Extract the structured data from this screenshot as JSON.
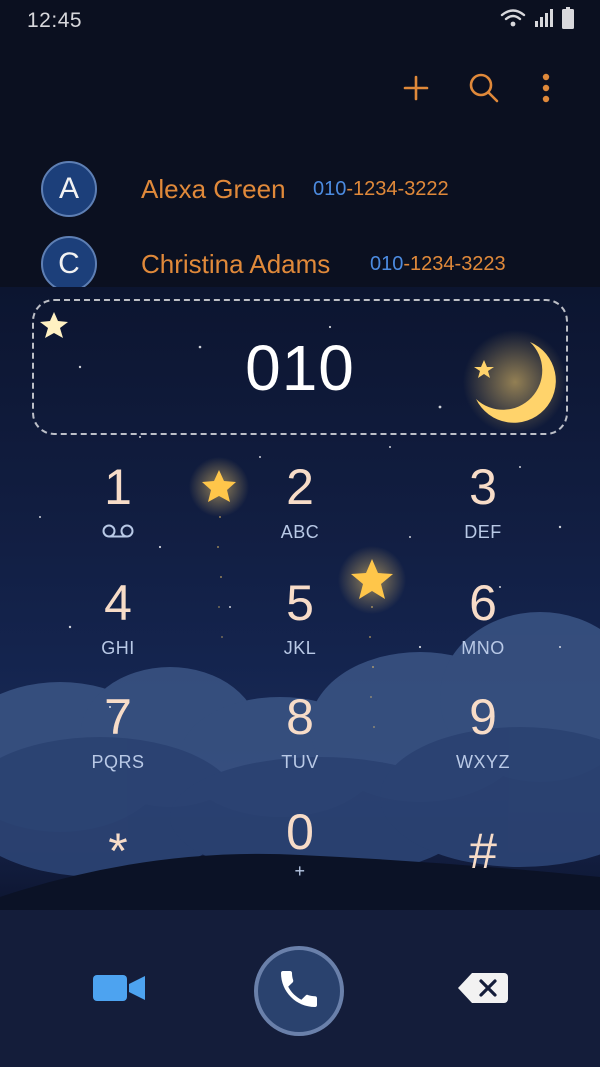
{
  "status_bar": {
    "time": "12:45",
    "icons": [
      "wifi-icon",
      "signal-icon",
      "battery-icon"
    ]
  },
  "toolbar": {
    "actions": [
      "add-icon",
      "search-icon",
      "more-vert-icon"
    ]
  },
  "contacts": [
    {
      "initial": "A",
      "name": "Alexa Green",
      "number_match": "010",
      "number_rest": "-1234-3222"
    },
    {
      "initial": "C",
      "name": "Christina Adams",
      "number_match": "010",
      "number_rest": "-1234-3223"
    }
  ],
  "dialer": {
    "entered_number": "010",
    "keys": [
      {
        "digit": "1",
        "letters": "",
        "icon": "voicemail-icon"
      },
      {
        "digit": "2",
        "letters": "ABC"
      },
      {
        "digit": "3",
        "letters": "DEF"
      },
      {
        "digit": "4",
        "letters": "GHI"
      },
      {
        "digit": "5",
        "letters": "JKL"
      },
      {
        "digit": "6",
        "letters": "MNO"
      },
      {
        "digit": "7",
        "letters": "PQRS"
      },
      {
        "digit": "8",
        "letters": "TUV"
      },
      {
        "digit": "9",
        "letters": "WXYZ"
      },
      {
        "digit": "*",
        "letters": ""
      },
      {
        "digit": "0",
        "letters": "+"
      },
      {
        "digit": "#",
        "letters": ""
      }
    ]
  },
  "bottom_bar": {
    "left": "video-call-icon",
    "center": "phone-call-icon",
    "right": "backspace-icon"
  },
  "colors": {
    "accent": "#e0893a",
    "match": "#4c8be0",
    "avatar": "#1c3f7a",
    "digit": "#f7dcc8",
    "star": "#ffc64a"
  }
}
